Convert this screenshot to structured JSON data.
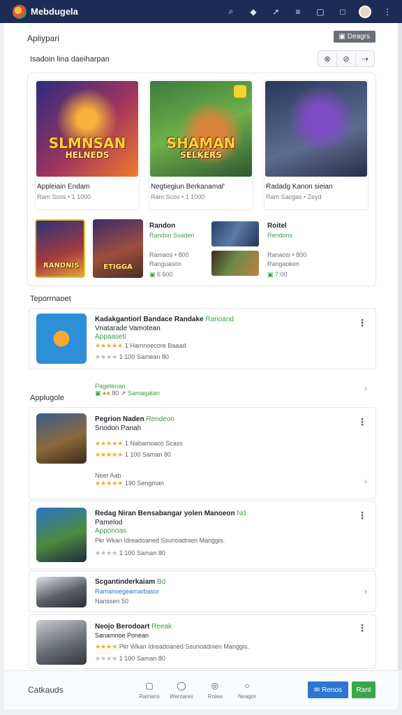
{
  "app": {
    "title": "Mebdugela"
  },
  "topbar": {
    "icons": [
      "search-icon",
      "diamond-icon",
      "chart-icon",
      "bookmark-icon",
      "square-icon",
      "square-outline-icon",
      "avatar",
      "more-icon"
    ]
  },
  "header": {
    "section1": "Apliypari",
    "action_button": "Deagrs"
  },
  "featured": {
    "title": "Isadoin lina daeiharpan",
    "segment": [
      "⊗",
      "⊘",
      "⇢"
    ],
    "cards": [
      {
        "art_line1": "SLMNSAN",
        "art_line2": "HELNEDS",
        "title": "Appleiain Endam",
        "sub": "Ram Scos • 1 1000"
      },
      {
        "art_line1": "SHAMAN",
        "art_line2": "SELKERS",
        "title": "Negtiegiun Berkanamal'",
        "sub": "Ram Scos • 1 1000"
      },
      {
        "art_line1": "",
        "art_line2": "",
        "title": "Radadg Kanon sieian",
        "sub": "Ram Sacgas • Zeyd"
      }
    ],
    "tiles": [
      {
        "art": "RANDNIS"
      },
      {
        "art": "ETIGGA"
      }
    ],
    "mini": [
      {
        "title": "Randon",
        "sub": "Randon Ssaden",
        "meta1": "Ramaos • 800",
        "meta2": "Ranguason",
        "meta3": "6 600"
      },
      {
        "title": "Roitel",
        "sub": "Rendons",
        "meta1": "Ranaosi • 800",
        "meta2": "Rangaoken",
        "meta3": "7:00"
      }
    ]
  },
  "section2": {
    "title": "Teporrnaoet"
  },
  "list1": [
    {
      "title": "Kadakgantiorl Bandace Randake",
      "title_green": "Rarioand",
      "sub": "Vnatarade Vamotean",
      "sub_green": "Appaaseti",
      "rating": "1 Hamnoecore Baaad",
      "meta": "1 100   Samean   80"
    }
  ],
  "footer1": {
    "left": "Pagetenan",
    "count": "80",
    "link": "Samagatan"
  },
  "section3": {
    "title": "Applugole"
  },
  "list2": [
    {
      "title": "Pegrion Naden",
      "title_green": "Rendeon",
      "sub": "Snodon Panah",
      "rating": "1 Nabamoaco Scass",
      "meta": "1 100   Saman   80",
      "footer_title": "Neer Aab",
      "footer_meta": "190   Sengman"
    },
    {
      "title": "Redag Niran Bensabangar yolen Manoeon",
      "title_green": "Nd",
      "sub": "Pamelod",
      "sub_green": "Apponoas",
      "desc": "Pkr Wkan Idreadoaned Ssurioadnien Manggis.",
      "meta": "1 100   Saman   80"
    },
    {
      "title": "Scgantinderkaiam",
      "title_green": "Bd",
      "sub": "Ramanoegeamarbasor",
      "sub2": "Nanssen 50"
    },
    {
      "title": "Neojo Berodoart",
      "title_green": "Reeak",
      "sub": "Sanamnoe Ponean",
      "desc": "Pkr Wkan Idreadoaned Ssurioadnien Manggis.",
      "meta": "1 100   Saman   80"
    }
  ],
  "bottom": {
    "label": "Catkauds",
    "nav": [
      "Ramans",
      "Wentares",
      "Roiea",
      "Neagor"
    ],
    "btn_primary": "Renos",
    "btn_secondary": "Rant"
  },
  "colors": {
    "topbar": "#1d2c57",
    "accent_blue": "#2a76d2",
    "accent_green": "#3aa64a",
    "star": "#f5a623"
  }
}
